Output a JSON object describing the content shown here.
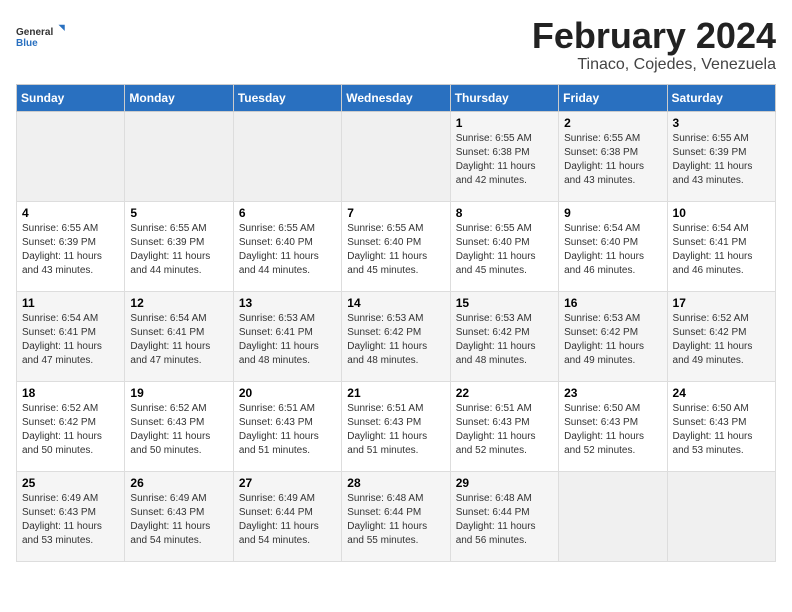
{
  "logo": {
    "line1": "General",
    "line2": "Blue"
  },
  "title": "February 2024",
  "subtitle": "Tinaco, Cojedes, Venezuela",
  "days_of_week": [
    "Sunday",
    "Monday",
    "Tuesday",
    "Wednesday",
    "Thursday",
    "Friday",
    "Saturday"
  ],
  "weeks": [
    [
      {
        "day": "",
        "info": ""
      },
      {
        "day": "",
        "info": ""
      },
      {
        "day": "",
        "info": ""
      },
      {
        "day": "",
        "info": ""
      },
      {
        "day": "1",
        "info": "Sunrise: 6:55 AM\nSunset: 6:38 PM\nDaylight: 11 hours\nand 42 minutes."
      },
      {
        "day": "2",
        "info": "Sunrise: 6:55 AM\nSunset: 6:38 PM\nDaylight: 11 hours\nand 43 minutes."
      },
      {
        "day": "3",
        "info": "Sunrise: 6:55 AM\nSunset: 6:39 PM\nDaylight: 11 hours\nand 43 minutes."
      }
    ],
    [
      {
        "day": "4",
        "info": "Sunrise: 6:55 AM\nSunset: 6:39 PM\nDaylight: 11 hours\nand 43 minutes."
      },
      {
        "day": "5",
        "info": "Sunrise: 6:55 AM\nSunset: 6:39 PM\nDaylight: 11 hours\nand 44 minutes."
      },
      {
        "day": "6",
        "info": "Sunrise: 6:55 AM\nSunset: 6:40 PM\nDaylight: 11 hours\nand 44 minutes."
      },
      {
        "day": "7",
        "info": "Sunrise: 6:55 AM\nSunset: 6:40 PM\nDaylight: 11 hours\nand 45 minutes."
      },
      {
        "day": "8",
        "info": "Sunrise: 6:55 AM\nSunset: 6:40 PM\nDaylight: 11 hours\nand 45 minutes."
      },
      {
        "day": "9",
        "info": "Sunrise: 6:54 AM\nSunset: 6:40 PM\nDaylight: 11 hours\nand 46 minutes."
      },
      {
        "day": "10",
        "info": "Sunrise: 6:54 AM\nSunset: 6:41 PM\nDaylight: 11 hours\nand 46 minutes."
      }
    ],
    [
      {
        "day": "11",
        "info": "Sunrise: 6:54 AM\nSunset: 6:41 PM\nDaylight: 11 hours\nand 47 minutes."
      },
      {
        "day": "12",
        "info": "Sunrise: 6:54 AM\nSunset: 6:41 PM\nDaylight: 11 hours\nand 47 minutes."
      },
      {
        "day": "13",
        "info": "Sunrise: 6:53 AM\nSunset: 6:41 PM\nDaylight: 11 hours\nand 48 minutes."
      },
      {
        "day": "14",
        "info": "Sunrise: 6:53 AM\nSunset: 6:42 PM\nDaylight: 11 hours\nand 48 minutes."
      },
      {
        "day": "15",
        "info": "Sunrise: 6:53 AM\nSunset: 6:42 PM\nDaylight: 11 hours\nand 48 minutes."
      },
      {
        "day": "16",
        "info": "Sunrise: 6:53 AM\nSunset: 6:42 PM\nDaylight: 11 hours\nand 49 minutes."
      },
      {
        "day": "17",
        "info": "Sunrise: 6:52 AM\nSunset: 6:42 PM\nDaylight: 11 hours\nand 49 minutes."
      }
    ],
    [
      {
        "day": "18",
        "info": "Sunrise: 6:52 AM\nSunset: 6:42 PM\nDaylight: 11 hours\nand 50 minutes."
      },
      {
        "day": "19",
        "info": "Sunrise: 6:52 AM\nSunset: 6:43 PM\nDaylight: 11 hours\nand 50 minutes."
      },
      {
        "day": "20",
        "info": "Sunrise: 6:51 AM\nSunset: 6:43 PM\nDaylight: 11 hours\nand 51 minutes."
      },
      {
        "day": "21",
        "info": "Sunrise: 6:51 AM\nSunset: 6:43 PM\nDaylight: 11 hours\nand 51 minutes."
      },
      {
        "day": "22",
        "info": "Sunrise: 6:51 AM\nSunset: 6:43 PM\nDaylight: 11 hours\nand 52 minutes."
      },
      {
        "day": "23",
        "info": "Sunrise: 6:50 AM\nSunset: 6:43 PM\nDaylight: 11 hours\nand 52 minutes."
      },
      {
        "day": "24",
        "info": "Sunrise: 6:50 AM\nSunset: 6:43 PM\nDaylight: 11 hours\nand 53 minutes."
      }
    ],
    [
      {
        "day": "25",
        "info": "Sunrise: 6:49 AM\nSunset: 6:43 PM\nDaylight: 11 hours\nand 53 minutes."
      },
      {
        "day": "26",
        "info": "Sunrise: 6:49 AM\nSunset: 6:43 PM\nDaylight: 11 hours\nand 54 minutes."
      },
      {
        "day": "27",
        "info": "Sunrise: 6:49 AM\nSunset: 6:44 PM\nDaylight: 11 hours\nand 54 minutes."
      },
      {
        "day": "28",
        "info": "Sunrise: 6:48 AM\nSunset: 6:44 PM\nDaylight: 11 hours\nand 55 minutes."
      },
      {
        "day": "29",
        "info": "Sunrise: 6:48 AM\nSunset: 6:44 PM\nDaylight: 11 hours\nand 56 minutes."
      },
      {
        "day": "",
        "info": ""
      },
      {
        "day": "",
        "info": ""
      }
    ]
  ]
}
